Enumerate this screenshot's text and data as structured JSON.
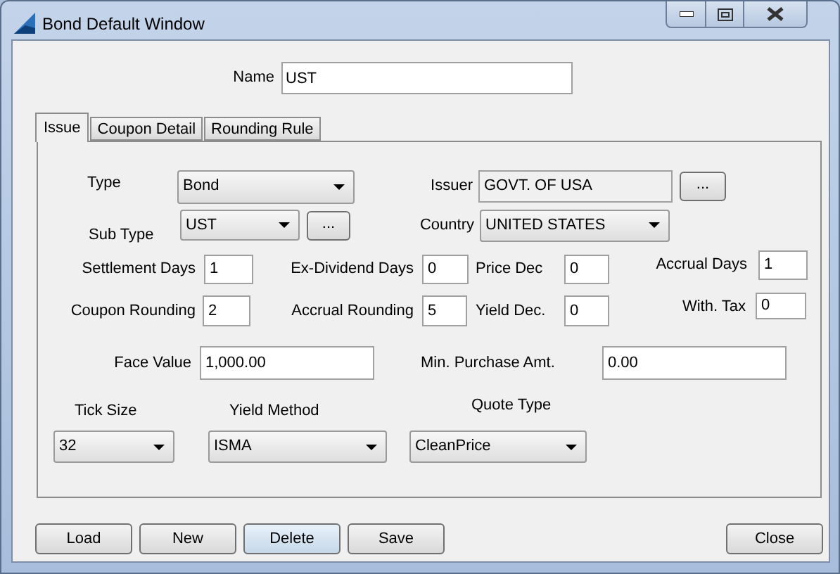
{
  "window": {
    "title": "Bond Default Window"
  },
  "name": {
    "label": "Name",
    "value": "UST"
  },
  "tabs": [
    {
      "label": "Issue",
      "selected": true
    },
    {
      "label": "Coupon Detail",
      "selected": false
    },
    {
      "label": "Rounding Rule",
      "selected": false
    }
  ],
  "fields": [
    {
      "label": "Type",
      "kind": "combo",
      "value": "Bond"
    },
    {
      "label": "Issuer",
      "kind": "readonly",
      "value": "GOVT. OF USA",
      "button": "..."
    },
    {
      "label": "Sub Type",
      "kind": "combo",
      "value": "UST",
      "button": "..."
    },
    {
      "label": "Country",
      "kind": "combo",
      "value": "UNITED STATES"
    },
    {
      "label": "Settlement Days",
      "kind": "text",
      "value": "1"
    },
    {
      "label": "Ex-Dividend Days",
      "kind": "text",
      "value": "0"
    },
    {
      "label": "Price Dec",
      "kind": "text",
      "value": "0"
    },
    {
      "label": "Accrual Days",
      "kind": "text",
      "value": "1"
    },
    {
      "label": "Coupon Rounding",
      "kind": "text",
      "value": "2"
    },
    {
      "label": "Accrual Rounding",
      "kind": "text",
      "value": "5"
    },
    {
      "label": "Yield Dec.",
      "kind": "text",
      "value": "0"
    },
    {
      "label": "With. Tax",
      "kind": "text",
      "value": "0"
    },
    {
      "label": "Face Value",
      "kind": "text",
      "value": "1,000.00"
    },
    {
      "label": "Min. Purchase Amt.",
      "kind": "text",
      "value": "0.00"
    },
    {
      "label": "Tick Size",
      "kind": "combo",
      "value": "32"
    },
    {
      "label": "Yield Method",
      "kind": "combo",
      "value": "ISMA"
    },
    {
      "label": "Quote Type",
      "kind": "combo",
      "value": "CleanPrice"
    }
  ],
  "buttons": [
    {
      "label": "Load",
      "hovered": false
    },
    {
      "label": "New",
      "hovered": false
    },
    {
      "label": "Delete",
      "hovered": true
    },
    {
      "label": "Save",
      "hovered": false
    },
    {
      "label": "Close",
      "hovered": false
    }
  ]
}
